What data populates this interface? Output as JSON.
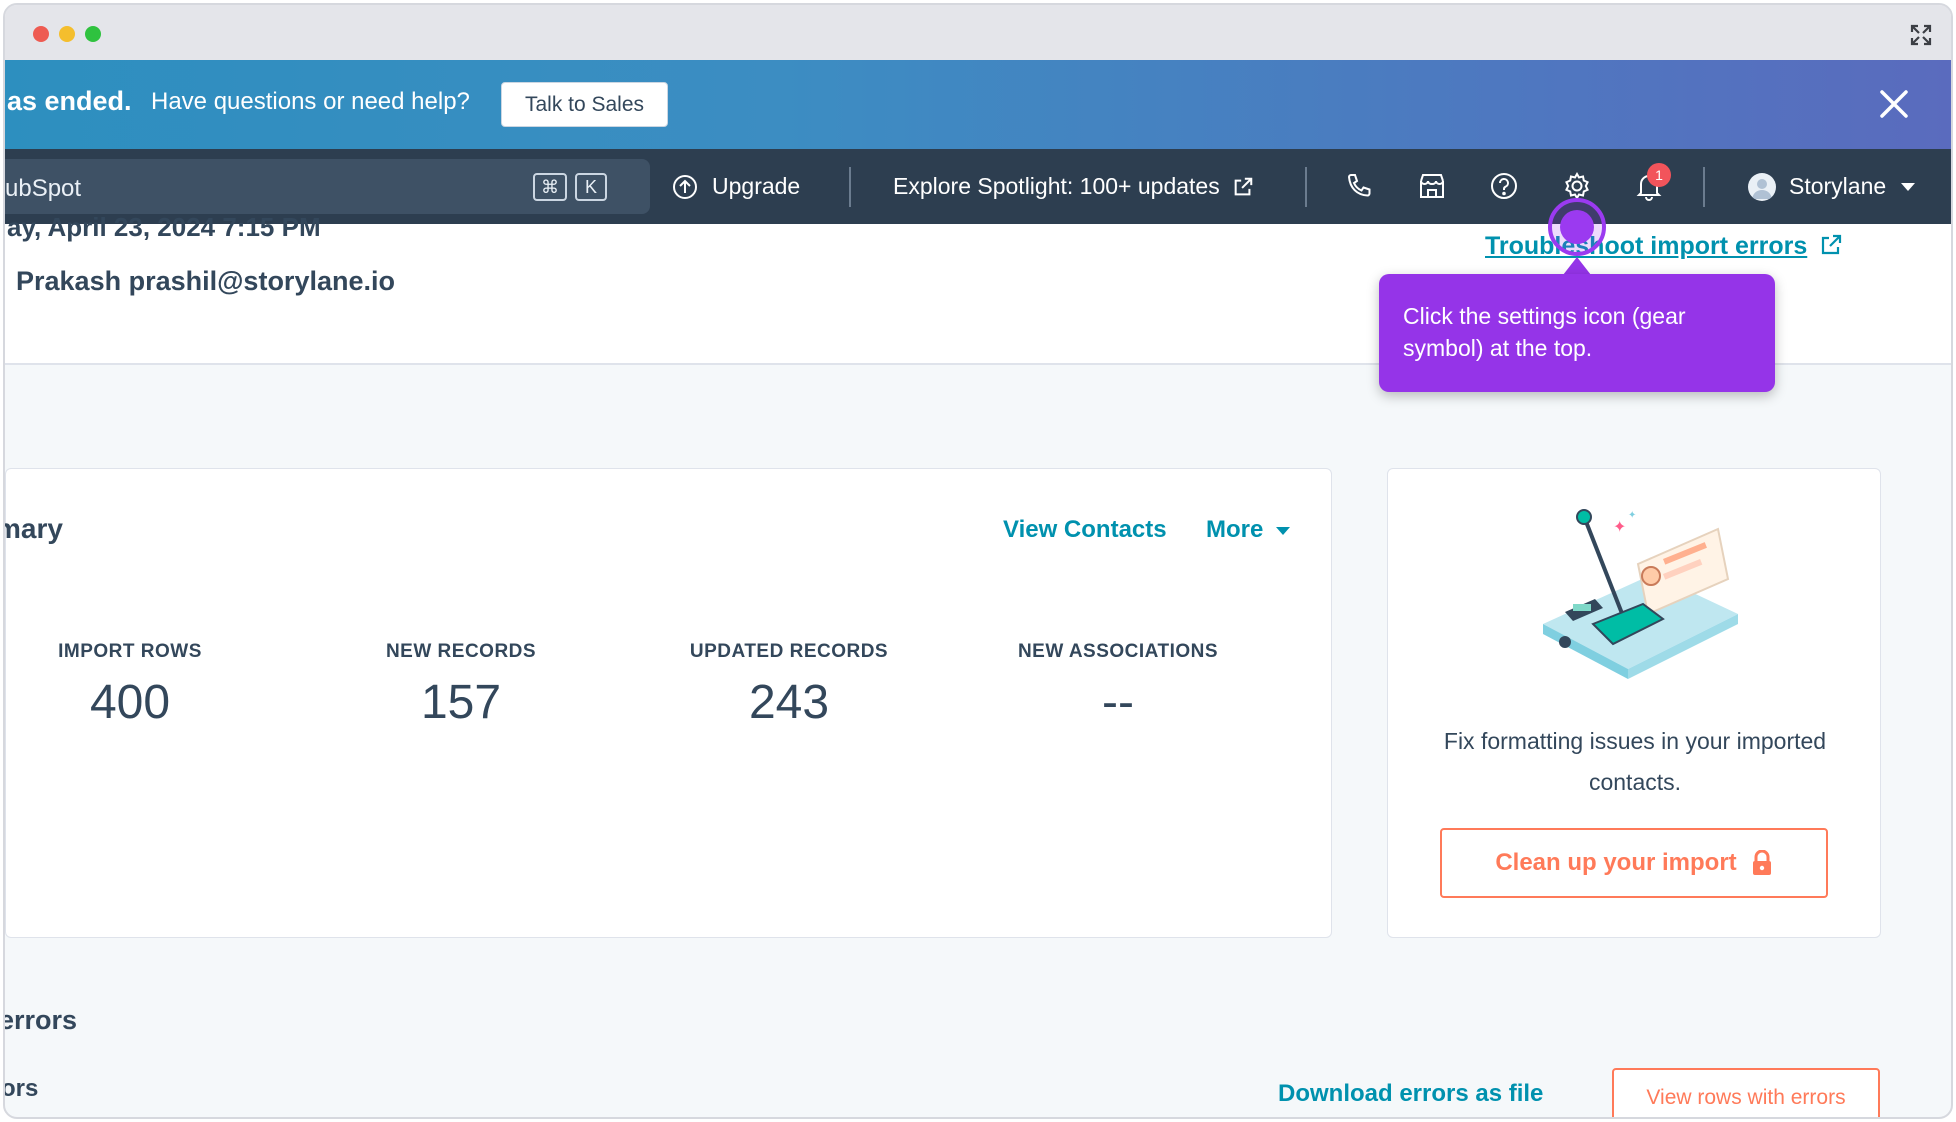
{
  "banner": {
    "strong_text": "as ended.",
    "text": "Have questions or need help?",
    "cta_label": "Talk to Sales"
  },
  "navbar": {
    "search_text": "ubSpot",
    "shortcut_cmd": "⌘",
    "shortcut_key": "K",
    "upgrade_label": "Upgrade",
    "spotlight_label": "Explore Spotlight: 100+ updates",
    "notification_count": "1",
    "account_name": "Storylane"
  },
  "header": {
    "date_line": "ay, April 23, 2024 7:15 PM",
    "user_line": "Prakash prashil@storylane.io",
    "troubleshoot_link": "Troubleshoot import errors"
  },
  "summary": {
    "title": "mary",
    "view_contacts": "View Contacts",
    "more": "More",
    "stats": [
      {
        "label": "IMPORT ROWS",
        "value": "400"
      },
      {
        "label": "NEW RECORDS",
        "value": "157"
      },
      {
        "label": "UPDATED RECORDS",
        "value": "243"
      },
      {
        "label": "NEW ASSOCIATIONS",
        "value": "--"
      }
    ]
  },
  "side_card": {
    "text": "Fix formatting issues in your imported contacts.",
    "cleanup_label": "Clean up your import"
  },
  "errors": {
    "title": "errors",
    "subtitle": "ors",
    "download_link": "Download errors as file",
    "view_rows_label": "View rows with errors"
  },
  "tooltip": {
    "text": "Click the settings icon (gear symbol) at the top."
  },
  "colors": {
    "nav_bg": "#2d3e50",
    "link": "#0091ae",
    "accent_orange": "#ff7a59",
    "tooltip_purple": "#9534e8"
  }
}
